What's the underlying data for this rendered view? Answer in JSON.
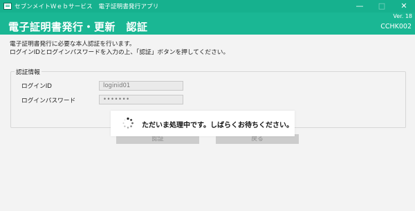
{
  "titlebar": {
    "title": "セブンメイトＷｅｂサービス　電子証明書発行アプリ",
    "minimize": "—",
    "maximize": "□",
    "close": "✕"
  },
  "header": {
    "version": "Ver. 18",
    "title": "電子証明書発行・更新　認証",
    "screen_code": "CCHK002"
  },
  "description": {
    "line1": "電子証明書発行に必要な本人認証を行います。",
    "line2": "ログインIDとログインパスワードを入力の上、「認証」ボタンを押してください。"
  },
  "auth_group": {
    "title": "認証情報",
    "login_id_label": "ログインID",
    "login_id_value": "loginid01",
    "password_label": "ログインパスワード",
    "password_value": "•••••••"
  },
  "buttons": {
    "authenticate": "認証",
    "back": "戻る"
  },
  "overlay": {
    "message": "ただいま処理中です。しばらくお待ちください。"
  },
  "colors": {
    "titlebar": "#16b18e",
    "header": "#1ab794",
    "background": "#f3f3f3",
    "disabled_button": "#cccccc"
  }
}
